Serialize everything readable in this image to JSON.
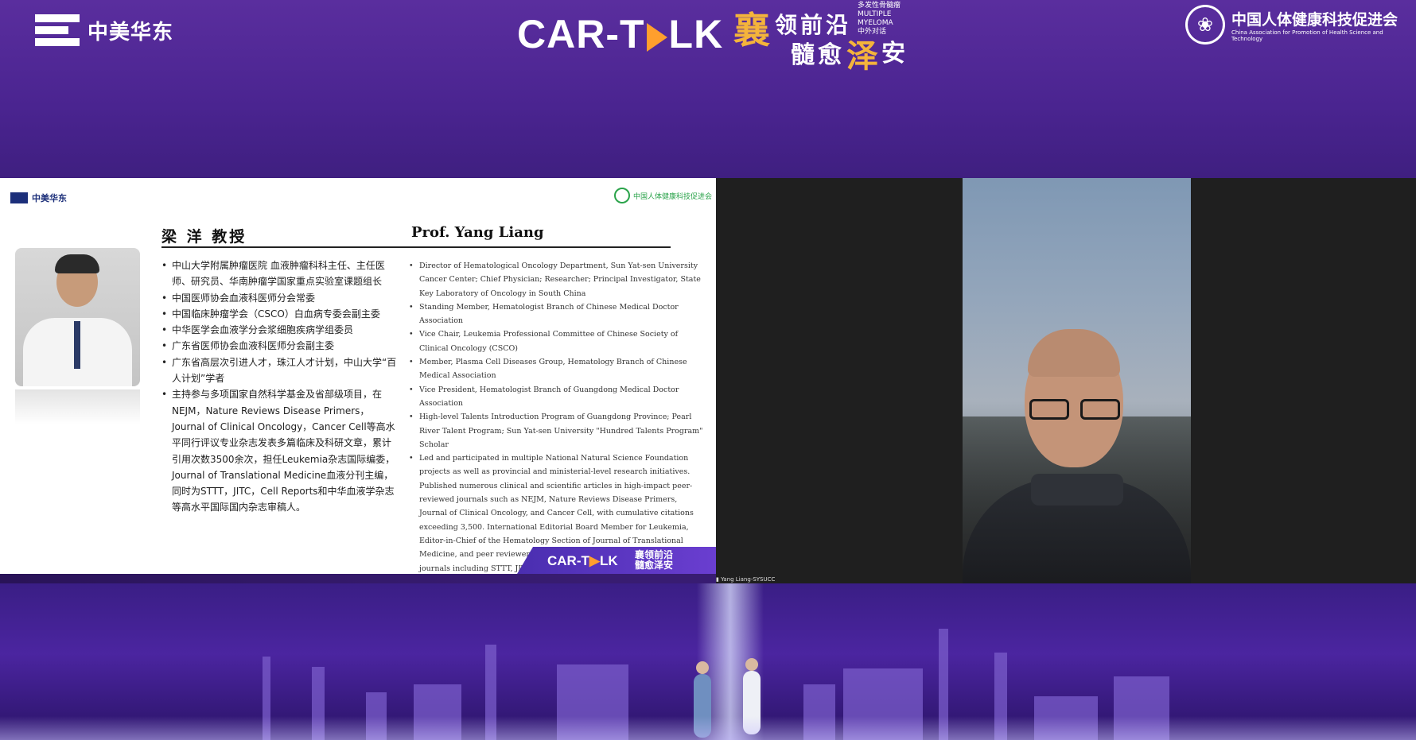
{
  "header": {
    "left_logo_text": "中美华东",
    "center_title": "CAR-T",
    "center_title_tail": "LK",
    "slogan": {
      "c1": "襄",
      "c2": "领",
      "c3": "前",
      "c4": "沿",
      "c5": "髓",
      "c6": "愈",
      "c7": "泽",
      "c8": "安",
      "sub1": "多发性骨髓瘤",
      "sub2": "MULTIPLE MYELOMA",
      "sub3": "中外对话"
    },
    "right_logo_cn": "中国人体健康科技促进会",
    "right_logo_en": "China Association for Promotion of Health Science and Technology"
  },
  "slide": {
    "logo_text": "中美华东",
    "cap_text": "中国人体健康科技促进会",
    "name_cn": "梁 洋 教授",
    "name_en": "Prof. Yang Liang",
    "cn_items": [
      "中山大学附属肿瘤医院 血液肿瘤科科主任、主任医师、研究员、华南肿瘤学国家重点实验室课题组长",
      "中国医师协会血液科医师分会常委",
      "中国临床肿瘤学会（CSCO）白血病专委会副主委",
      "中华医学会血液学分会浆细胞疾病学组委员",
      "广东省医师协会血液科医师分会副主委",
      "广东省高层次引进人才，珠江人才计划，中山大学“百人计划”学者",
      "主持参与多项国家自然科学基金及省部级项目，在NEJM，Nature Reviews Disease Primers， Journal of Clinical Oncology，Cancer Cell等高水平同行评议专业杂志发表多篇临床及科研文章，累计引用次数3500余次，担任Leukemia杂志国际编委，Journal of Translational Medicine血液分刊主编，同时为STTT，JITC，Cell Reports和中华血液学杂志等高水平国际国内杂志审稿人。"
    ],
    "en_items": [
      "Director of Hematological Oncology Department, Sun Yat-sen University Cancer Center; Chief Physician; Researcher; Principal Investigator, State Key Laboratory of Oncology in South China",
      "Standing Member, Hematologist Branch of Chinese Medical Doctor Association",
      "Vice Chair, Leukemia Professional Committee of Chinese Society of Clinical Oncology (CSCO)",
      "Member, Plasma Cell Diseases Group, Hematology Branch of Chinese Medical Association",
      "Vice President, Hematologist Branch of Guangdong Medical Doctor Association",
      "High-level Talents Introduction Program of Guangdong Province; Pearl River Talent Program; Sun Yat-sen University \"Hundred Talents Program\" Scholar",
      "Led and participated in multiple National Natural Science Foundation projects as well as provincial and ministerial-level research initiatives. Published numerous clinical and scientific articles in high-impact peer-reviewed journals such as NEJM, Nature Reviews Disease Primers, Journal of Clinical Oncology, and Cancer Cell, with cumulative citations exceeding 3,500. International Editorial Board Member for Leukemia, Editor-in-Chief of the Hematology Section of Journal of Translational Medicine, and peer reviewer for prestigious international and domestic journals including STTT, JITC, Cell Reports, and Chinese Journal of Hematology."
    ],
    "footer_title": "CAR-T",
    "footer_title_tail": "LK",
    "footer_slogan_1": "襄领前沿",
    "footer_slogan_2": "髓愈泽安"
  },
  "video": {
    "participant_label": "Yang Liang-SYSUCC"
  },
  "colors": {
    "banner_purple": "#4a2490",
    "accent_orange": "#ff9f2d",
    "slogan_gold": "#f4b43b",
    "cap_green": "#2aa34a"
  }
}
